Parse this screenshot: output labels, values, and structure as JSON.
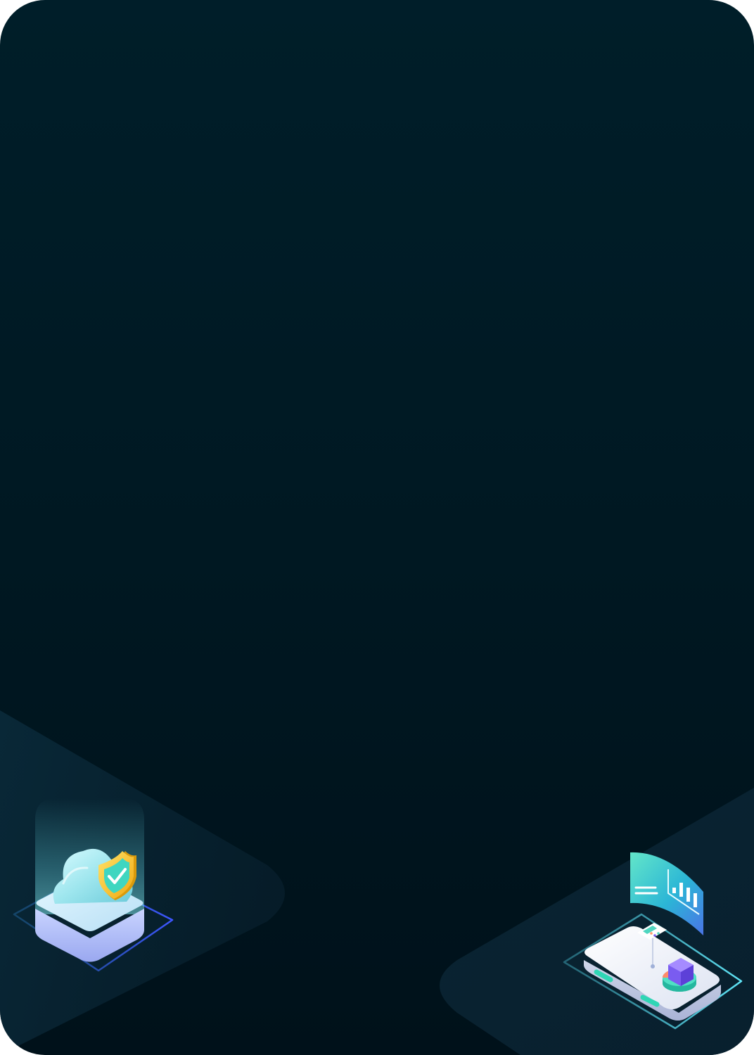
{
  "card": {
    "background_top": "#001e29",
    "background_bottom": "#00111a"
  },
  "illustrations": {
    "left": {
      "icon": "cloud-shield-check-icon",
      "accent": "#f5c21b"
    },
    "right": {
      "icon": "dashboard-platform-icon",
      "accent": "#2fd6b5"
    }
  }
}
